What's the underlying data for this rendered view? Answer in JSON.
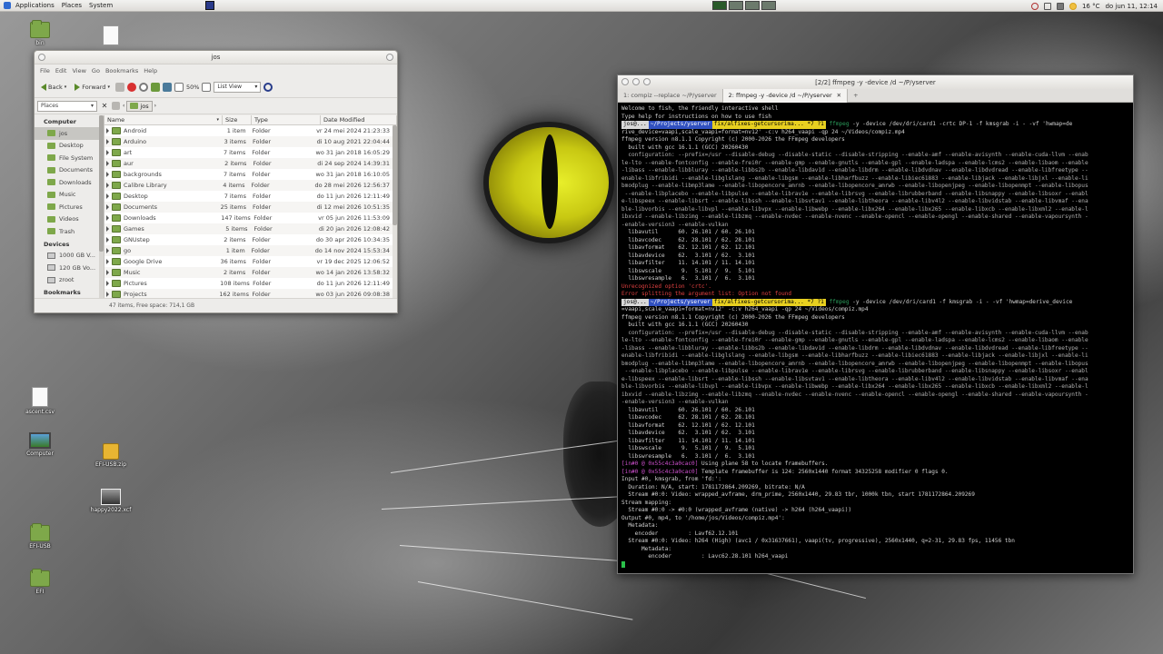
{
  "top_panel": {
    "menu": [
      "Applications",
      "Places",
      "System"
    ],
    "clock": "do jun 11, 12:14",
    "weather": "16 °C",
    "icons": [
      "applications-icon",
      "terminal-launcher-icon",
      "notifications-off-icon",
      "network-icon",
      "volume-icon",
      "weather-sun-icon"
    ]
  },
  "desktop": {
    "icons": [
      {
        "name": "bin",
        "kind": "folder"
      },
      {
        "name": "ascent.csv",
        "kind": "file"
      },
      {
        "name": "Computer",
        "kind": "computer"
      },
      {
        "name": "EFI-USB.zip",
        "kind": "zip"
      },
      {
        "name": "happy2022.xcf",
        "kind": "image"
      },
      {
        "name": "EFI-USB",
        "kind": "folder"
      },
      {
        "name": "EFI",
        "kind": "folder"
      }
    ]
  },
  "file_manager": {
    "title": "jos",
    "menu": [
      "File",
      "Edit",
      "View",
      "Go",
      "Bookmarks",
      "Help"
    ],
    "toolbar": {
      "back": "Back",
      "forward": "Forward",
      "zoom": "50%",
      "view_mode": "List View"
    },
    "location": {
      "side_pane": "Places",
      "crumb": "jos"
    },
    "sidebar": {
      "computer_heading": "Computer",
      "computer_items": [
        "jos",
        "Desktop",
        "File System",
        "Documents",
        "Downloads",
        "Music",
        "Pictures",
        "Videos",
        "Trash"
      ],
      "devices_heading": "Devices",
      "device_items": [
        "1000 GB V...",
        "120 GB Vo...",
        "zroot"
      ],
      "bookmarks_heading": "Bookmarks",
      "bookmark_items": [
        "Projects"
      ]
    },
    "columns": [
      "Name",
      "Size",
      "Type",
      "Date Modified"
    ],
    "rows": [
      {
        "name": "Android",
        "size": "1 item",
        "type": "Folder",
        "date": "vr 24 mei 2024 21:23:33"
      },
      {
        "name": "Arduino",
        "size": "3 items",
        "type": "Folder",
        "date": "di 10 aug 2021 22:04:44"
      },
      {
        "name": "art",
        "size": "7 items",
        "type": "Folder",
        "date": "wo 31 jan 2018 16:05:29"
      },
      {
        "name": "aur",
        "size": "2 items",
        "type": "Folder",
        "date": "di 24 sep 2024 14:39:31"
      },
      {
        "name": "backgrounds",
        "size": "7 items",
        "type": "Folder",
        "date": "wo 31 jan 2018 16:10:05"
      },
      {
        "name": "Calibre Library",
        "size": "4 items",
        "type": "Folder",
        "date": "do 28 mei 2026 12:56:37"
      },
      {
        "name": "Desktop",
        "size": "7 items",
        "type": "Folder",
        "date": "do 11 jun 2026 12:11:49"
      },
      {
        "name": "Documents",
        "size": "25 items",
        "type": "Folder",
        "date": "di 12 mei 2026 10:51:35"
      },
      {
        "name": "Downloads",
        "size": "147 items",
        "type": "Folder",
        "date": "vr 05 jun 2026 11:53:09"
      },
      {
        "name": "Games",
        "size": "5 items",
        "type": "Folder",
        "date": "di 20 jan 2026 12:08:42"
      },
      {
        "name": "GNUstep",
        "size": "2 items",
        "type": "Folder",
        "date": "do 30 apr 2026 10:34:35"
      },
      {
        "name": "go",
        "size": "1 item",
        "type": "Folder",
        "date": "do 14 nov 2024 15:53:34"
      },
      {
        "name": "Google Drive",
        "size": "36 items",
        "type": "Folder",
        "date": "vr 19 dec 2025 12:06:52"
      },
      {
        "name": "Music",
        "size": "2 items",
        "type": "Folder",
        "date": "wo 14 jan 2026 13:58:32"
      },
      {
        "name": "Pictures",
        "size": "108 items",
        "type": "Folder",
        "date": "do 11 jun 2026 12:11:49"
      },
      {
        "name": "Projects",
        "size": "162 items",
        "type": "Folder",
        "date": "wo 03 jun 2026 09:08:38"
      }
    ],
    "status": "47 items, Free space: 714,1 GB"
  },
  "terminal": {
    "title": "[2/2] ffmpeg -y -device /d ~/P/yserver",
    "tabs": [
      {
        "label": "1: compiz --replace ~/P/yserver",
        "active": false
      },
      {
        "label": "2: ffmpeg -y -device /d ~/P/yserver",
        "active": true
      }
    ],
    "prompt": {
      "host": "jos@...",
      "dir": "~/Projects/yserver",
      "git": "fix/alfixes-getcursorima... *7 ?1"
    },
    "lines": [
      {
        "t": "Welcome to fish, the friendly interactive shell",
        "c": ""
      },
      {
        "t": "Type help for instructions on how to use fish",
        "c": ""
      },
      {
        "t": "$PROMPT$ffmpeg -y -device /dev/dri/card1 -crtc DP-1 -f kmsgrab -i - -vf 'hwmap=de",
        "c": "prompt"
      },
      {
        "t": "rive_device=vaapi,scale_vaapi=format=nv12' -c:v h264_vaapi -qp 24 ~/Videos/compiz.mp4",
        "c": ""
      },
      {
        "t": "ffmpeg version n8.1.1 Copyright (c) 2000-2026 the FFmpeg developers",
        "c": ""
      },
      {
        "t": "  built with gcc 16.1.1 (GCC) 20260430",
        "c": ""
      },
      {
        "t": "  configuration: --prefix=/usr --disable-debug --disable-static --disable-stripping --enable-amf --enable-avisynth --enable-cuda-llvm --enab",
        "c": "gray"
      },
      {
        "t": "le-lto --enable-fontconfig --enable-frei0r --enable-gmp --enable-gnutls --enable-gpl --enable-ladspa --enable-lcms2 --enable-libaom --enable",
        "c": "gray"
      },
      {
        "t": "-libass --enable-libbluray --enable-libbs2b --enable-libdav1d --enable-libdrm --enable-libdvdnav --enable-libdvdread --enable-libfreetype --",
        "c": "gray"
      },
      {
        "t": "enable-libfribidi --enable-libglslang --enable-libgsm --enable-libharfbuzz --enable-libiec61883 --enable-libjack --enable-libjxl --enable-li",
        "c": "gray"
      },
      {
        "t": "bmodplug --enable-libmp3lame --enable-libopencore_amrnb --enable-libopencore_amrwb --enable-libopenjpeg --enable-libopenmpt --enable-libopus",
        "c": "gray"
      },
      {
        "t": " --enable-libplacebo --enable-libpulse --enable-librav1e --enable-librsvg --enable-librubberband --enable-libsnappy --enable-libsoxr --enabl",
        "c": "gray"
      },
      {
        "t": "e-libspeex --enable-libsrt --enable-libssh --enable-libsvtav1 --enable-libtheora --enable-libv4l2 --enable-libvidstab --enable-libvmaf --ena",
        "c": "gray"
      },
      {
        "t": "ble-libvorbis --enable-libvpl --enable-libvpx --enable-libwebp --enable-libx264 --enable-libx265 --enable-libxcb --enable-libxml2 --enable-l",
        "c": "gray"
      },
      {
        "t": "ibxvid --enable-libzimg --enable-libzmq --enable-nvdec --enable-nvenc --enable-opencl --enable-opengl --enable-shared --enable-vapoursynth -",
        "c": "gray"
      },
      {
        "t": "-enable-version3 --enable-vulkan",
        "c": "gray"
      },
      {
        "t": "  libavutil      60. 26.101 / 60. 26.101",
        "c": ""
      },
      {
        "t": "  libavcodec     62. 28.101 / 62. 28.101",
        "c": ""
      },
      {
        "t": "  libavformat    62. 12.101 / 62. 12.101",
        "c": ""
      },
      {
        "t": "  libavdevice    62.  3.101 / 62.  3.101",
        "c": ""
      },
      {
        "t": "  libavfilter    11. 14.101 / 11. 14.101",
        "c": ""
      },
      {
        "t": "  libswscale      9.  5.101 /  9.  5.101",
        "c": ""
      },
      {
        "t": "  libswresample   6.  3.101 /  6.  3.101",
        "c": ""
      },
      {
        "t": "Unrecognized option 'crtc'.",
        "c": "red"
      },
      {
        "t": "Error splitting the argument list: Option not found",
        "c": "red"
      },
      {
        "t": "$PROMPT$ffmpeg -y -device /dev/dri/card1 -f kmsgrab -i - -vf 'hwmap=derive_device",
        "c": "prompt"
      },
      {
        "t": "=vaapi,scale_vaapi=format=nv12' -c:v h264_vaapi -qp 24 ~/Videos/compiz.mp4",
        "c": ""
      },
      {
        "t": "ffmpeg version n8.1.1 Copyright (c) 2000-2026 the FFmpeg developers",
        "c": ""
      },
      {
        "t": "  built with gcc 16.1.1 (GCC) 20260430",
        "c": ""
      },
      {
        "t": "  configuration: --prefix=/usr --disable-debug --disable-static --disable-stripping --enable-amf --enable-avisynth --enable-cuda-llvm --enab",
        "c": "gray"
      },
      {
        "t": "le-lto --enable-fontconfig --enable-frei0r --enable-gmp --enable-gnutls --enable-gpl --enable-ladspa --enable-lcms2 --enable-libaom --enable",
        "c": "gray"
      },
      {
        "t": "-libass --enable-libbluray --enable-libbs2b --enable-libdav1d --enable-libdrm --enable-libdvdnav --enable-libdvdread --enable-libfreetype --",
        "c": "gray"
      },
      {
        "t": "enable-libfribidi --enable-libglslang --enable-libgsm --enable-libharfbuzz --enable-libiec61883 --enable-libjack --enable-libjxl --enable-li",
        "c": "gray"
      },
      {
        "t": "bmodplug --enable-libmp3lame --enable-libopencore_amrnb --enable-libopencore_amrwb --enable-libopenjpeg --enable-libopenmpt --enable-libopus",
        "c": "gray"
      },
      {
        "t": " --enable-libplacebo --enable-libpulse --enable-librav1e --enable-librsvg --enable-librubberband --enable-libsnappy --enable-libsoxr --enabl",
        "c": "gray"
      },
      {
        "t": "e-libspeex --enable-libsrt --enable-libssh --enable-libsvtav1 --enable-libtheora --enable-libv4l2 --enable-libvidstab --enable-libvmaf --ena",
        "c": "gray"
      },
      {
        "t": "ble-libvorbis --enable-libvpl --enable-libvpx --enable-libwebp --enable-libx264 --enable-libx265 --enable-libxcb --enable-libxml2 --enable-l",
        "c": "gray"
      },
      {
        "t": "ibxvid --enable-libzimg --enable-libzmq --enable-nvdec --enable-nvenc --enable-opencl --enable-opengl --enable-shared --enable-vapoursynth -",
        "c": "gray"
      },
      {
        "t": "-enable-version3 --enable-vulkan",
        "c": "gray"
      },
      {
        "t": "  libavutil      60. 26.101 / 60. 26.101",
        "c": ""
      },
      {
        "t": "  libavcodec     62. 28.101 / 62. 28.101",
        "c": ""
      },
      {
        "t": "  libavformat    62. 12.101 / 62. 12.101",
        "c": ""
      },
      {
        "t": "  libavdevice    62.  3.101 / 62.  3.101",
        "c": ""
      },
      {
        "t": "  libavfilter    11. 14.101 / 11. 14.101",
        "c": ""
      },
      {
        "t": "  libswscale      9.  5.101 /  9.  5.101",
        "c": ""
      },
      {
        "t": "  libswresample   6.  3.101 /  6.  3.101",
        "c": ""
      },
      {
        "t": "[in#0 @ 0x55c4c3a0cac0] Using plane 58 to locate framebuffers.",
        "c": "tagged"
      },
      {
        "t": "[in#0 @ 0x55c4c3a0cac0] Template framebuffer is 124: 2560x1440 format 34325258 modifier 0 flags 0.",
        "c": "tagged"
      },
      {
        "t": "Input #0, kmsgrab, from 'fd:':",
        "c": ""
      },
      {
        "t": "  Duration: N/A, start: 1781172864.209269, bitrate: N/A",
        "c": ""
      },
      {
        "t": "  Stream #0:0: Video: wrapped_avframe, drm_prime, 2560x1440, 29.83 tbr, 1000k tbn, start 1781172864.209269",
        "c": ""
      },
      {
        "t": "Stream mapping:",
        "c": ""
      },
      {
        "t": "  Stream #0:0 -> #0:0 (wrapped_avframe (native) -> h264 (h264_vaapi))",
        "c": ""
      },
      {
        "t": "Output #0, mp4, to '/home/jos/Videos/compiz.mp4':",
        "c": ""
      },
      {
        "t": "  Metadata:",
        "c": ""
      },
      {
        "t": "    encoder         : Lavf62.12.101",
        "c": ""
      },
      {
        "t": "  Stream #0:0: Video: h264 (High) (avc1 / 0x31637661), vaapi(tv, progressive), 2560x1440, q=2-31, 29.83 fps, 11456 tbn",
        "c": ""
      },
      {
        "t": "      Metadata:",
        "c": ""
      },
      {
        "t": "        encoder         : Lavc62.28.101 h264_vaapi",
        "c": ""
      }
    ]
  }
}
